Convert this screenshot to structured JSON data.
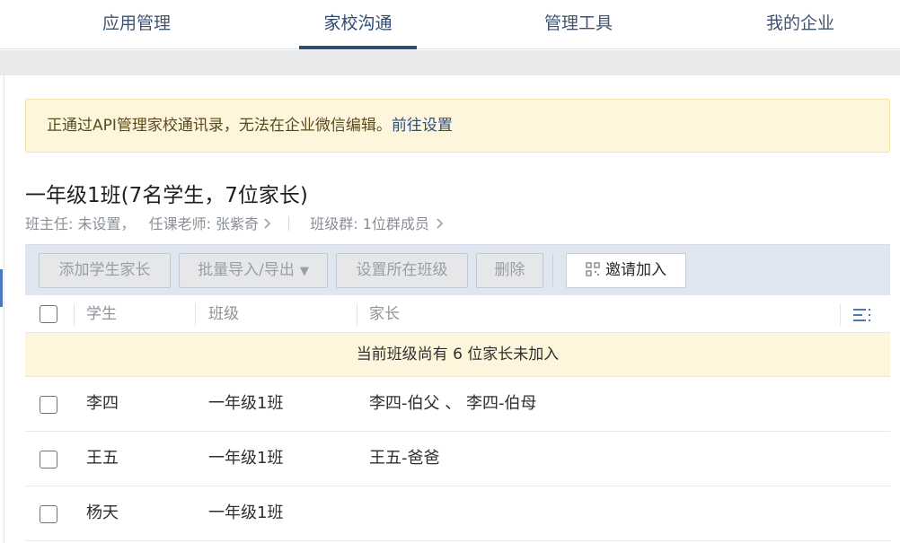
{
  "nav": {
    "tabs": [
      {
        "label": "应用管理"
      },
      {
        "label": "家校沟通"
      },
      {
        "label": "管理工具"
      },
      {
        "label": "我的企业"
      }
    ],
    "active_index": 1
  },
  "notice": {
    "text": "正通过API管理家校通讯录，无法在企业微信编辑。",
    "link": "前往设置"
  },
  "class_info": {
    "title": "一年级1班(7名学生，7位家长)",
    "head_teacher": "班主任: 未设置，",
    "teacher": "任课老师: 张紫奇",
    "group": "班级群: 1位群成员"
  },
  "toolbar": {
    "add_label": "添加学生家长",
    "import_label": "批量导入/导出",
    "set_class_label": "设置所在班级",
    "delete_label": "删除",
    "invite_label": "邀请加入"
  },
  "table": {
    "headers": {
      "student": "学生",
      "class": "班级",
      "parent": "家长"
    },
    "pending_text": "当前班级尚有 6 位家长未加入",
    "rows": [
      {
        "student": "李四",
        "class": "一年级1班",
        "parent": "李四-伯父 、 李四-伯母"
      },
      {
        "student": "王五",
        "class": "一年级1班",
        "parent": "王五-爸爸"
      },
      {
        "student": "杨天",
        "class": "一年级1班",
        "parent": ""
      }
    ]
  },
  "colors": {
    "accent": "#2f4d74",
    "notice_bg": "#fdf6dc",
    "toolbar_bg": "#dfe6f0"
  },
  "icons": {
    "chevron": "chevron-right-icon",
    "caret": "caret-down-icon",
    "qr": "qrcode-icon",
    "columns": "column-settings-icon"
  }
}
